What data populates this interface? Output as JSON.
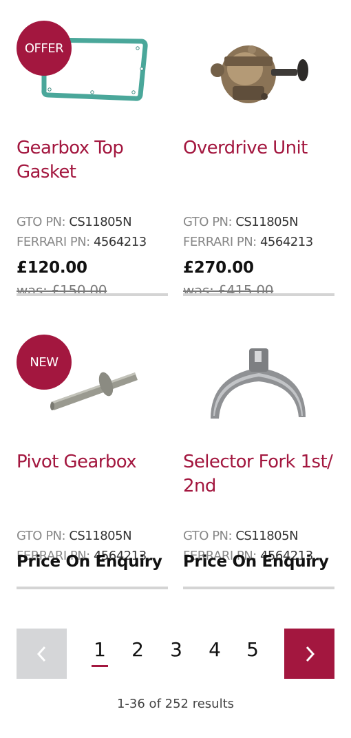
{
  "products": [
    {
      "badge": "OFFER",
      "title_line1": "Gearbox Top",
      "title_line2": "Gasket",
      "gto_label": "GTO PN:",
      "gto_value": "CS11805N",
      "ferrari_label": "FERRARI PN:",
      "ferrari_value": "4564213",
      "price": "£120.00",
      "was": "was: £150.00"
    },
    {
      "title_line1": "Overdrive Unit",
      "gto_label": "GTO PN:",
      "gto_value": "CS11805N",
      "ferrari_label": "FERRARI PN:",
      "ferrari_value": "4564213",
      "price": "£270.00",
      "was": "was: £415.00"
    },
    {
      "badge": "NEW",
      "title_line1": "Pivot Gearbox",
      "gto_label": "GTO PN:",
      "gto_value": "CS11805N",
      "ferrari_label": "FERRARI PN:",
      "ferrari_value": "4564213",
      "price": "Price On Enquiry"
    },
    {
      "title_line1": "Selector Fork 1st/",
      "title_line2": "2nd",
      "gto_label": "GTO PN:",
      "gto_value": "CS11805N",
      "ferrari_label": "FERRARI PN:",
      "ferrari_value": "4564213",
      "price": "Price On Enquiry"
    }
  ],
  "pagination": {
    "pages": [
      "1",
      "2",
      "3",
      "4",
      "5"
    ],
    "current": "1",
    "prev_icon": "chevron-left-icon",
    "next_icon": "chevron-right-icon"
  },
  "results_text": "1-36 of 252 results",
  "colors": {
    "accent": "#a3173f",
    "rule": "#d4d4d4",
    "prev_bg": "#d5d6d8"
  }
}
